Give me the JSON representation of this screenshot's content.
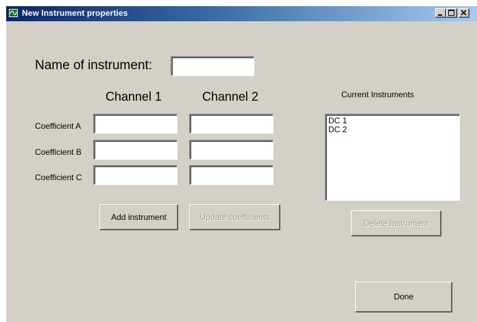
{
  "window": {
    "title": "New Instrument properties",
    "icon": "instrument-app-icon",
    "controls": [
      "minimize-icon",
      "maximize-icon",
      "close-icon"
    ]
  },
  "form": {
    "name_label": "Name of instrument:",
    "name_value": "",
    "channel1_header": "Channel 1",
    "channel2_header": "Channel 2",
    "coefficients": [
      {
        "label": "Coefficient A",
        "channel1": "",
        "channel2": ""
      },
      {
        "label": "Coefficient B",
        "channel1": "",
        "channel2": ""
      },
      {
        "label": "Coefficient C",
        "channel1": "",
        "channel2": ""
      }
    ],
    "add_button": "Add instrument",
    "update_button": "Update coefficients"
  },
  "instruments": {
    "header": "Current Instruments",
    "items": [
      "DC 1",
      "DC 2"
    ],
    "delete_button": "Delete Instrument"
  },
  "done_button": "Done",
  "colors": {
    "window_bg": "#d4d0c8",
    "titlebar_start": "#0a246a",
    "titlebar_end": "#a6caf0",
    "disabled_text": "#9e9b94"
  }
}
